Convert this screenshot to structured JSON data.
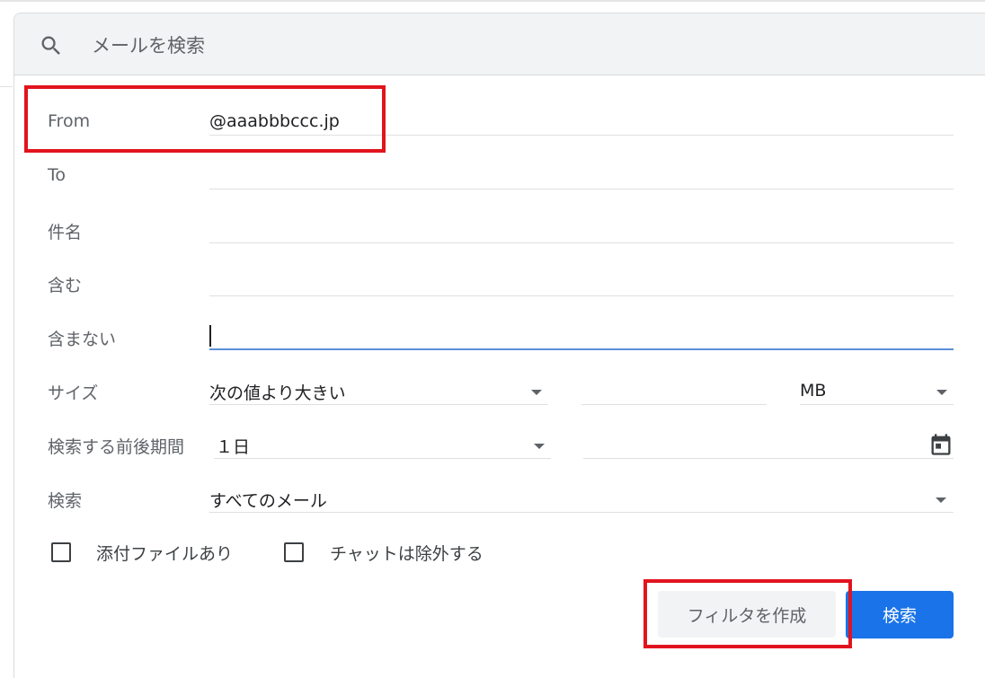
{
  "search": {
    "placeholder": "メールを検索",
    "icon": "search-icon"
  },
  "fields": {
    "from": {
      "label": "From",
      "value": "@aaabbbccc.jp"
    },
    "to": {
      "label": "To",
      "value": ""
    },
    "subject": {
      "label": "件名",
      "value": ""
    },
    "has_words": {
      "label": "含む",
      "value": ""
    },
    "doesnt_have": {
      "label": "含まない",
      "value": ""
    }
  },
  "size": {
    "label": "サイズ",
    "operator": "次の値より大きい",
    "value": "",
    "unit": "MB"
  },
  "date_within": {
    "label": "検索する前後期間",
    "value": "１日",
    "date": "",
    "icon": "calendar-icon"
  },
  "search_scope": {
    "label": "検索",
    "value": "すべてのメール"
  },
  "checkboxes": {
    "has_attachment": {
      "label": "添付ファイルあり",
      "checked": false
    },
    "exclude_chats": {
      "label": "チャットは除外する",
      "checked": false
    }
  },
  "buttons": {
    "create_filter": "フィルタを作成",
    "search": "検索"
  },
  "colors": {
    "primary": "#1a73e8",
    "highlight": "#e1141e",
    "search_bar": "#f1f3f4"
  }
}
